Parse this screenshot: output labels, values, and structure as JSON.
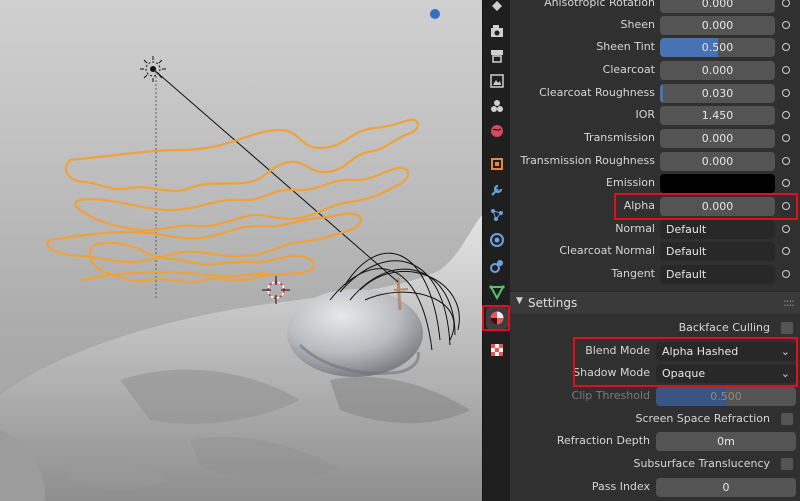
{
  "viewport": {
    "bg_color": "#bdbdbd",
    "curve_color": "#f0a23a"
  },
  "tabs": [
    {
      "name": "tool-icon",
      "color": "#cfcfcf"
    },
    {
      "name": "render-icon",
      "color": "#cfcfcf"
    },
    {
      "name": "output-icon",
      "color": "#cfcfcf"
    },
    {
      "name": "view-layer-icon",
      "color": "#cfcfcf"
    },
    {
      "name": "scene-icon",
      "color": "#cfcfcf"
    },
    {
      "name": "world-icon",
      "color": "#d64a5a"
    },
    {
      "name": "object-icon",
      "color": "#e8873a"
    },
    {
      "name": "modifier-icon",
      "color": "#6aa1e0"
    },
    {
      "name": "particles-icon",
      "color": "#6aa1e0"
    },
    {
      "name": "physics-icon",
      "color": "#6aa1e0"
    },
    {
      "name": "constraints-icon",
      "color": "#6aa1e0"
    },
    {
      "name": "data-icon",
      "color": "#56c26a"
    },
    {
      "name": "material-icon",
      "color": "#e05a5a",
      "active": true
    },
    {
      "name": "texture-icon",
      "color": "#e05a5a"
    }
  ],
  "props": {
    "anisotropic_rotation": {
      "label": "Anisotropic Rotation",
      "value": "0.000"
    },
    "sheen": {
      "label": "Sheen",
      "value": "0.000"
    },
    "sheen_tint": {
      "label": "Sheen Tint",
      "value": "0.500",
      "fraction": 0.5
    },
    "clearcoat": {
      "label": "Clearcoat",
      "value": "0.000"
    },
    "clearcoat_roughness": {
      "label": "Clearcoat Roughness",
      "value": "0.030",
      "fraction": 0.03
    },
    "ior": {
      "label": "IOR",
      "value": "1.450"
    },
    "transmission": {
      "label": "Transmission",
      "value": "0.000"
    },
    "transmission_roughness": {
      "label": "Transmission Roughness",
      "value": "0.000"
    },
    "emission": {
      "label": "Emission",
      "color": "#000000"
    },
    "alpha": {
      "label": "Alpha",
      "value": "0.000"
    },
    "normal": {
      "label": "Normal",
      "value": "Default"
    },
    "clearcoat_normal": {
      "label": "Clearcoat Normal",
      "value": "Default"
    },
    "tangent": {
      "label": "Tangent",
      "value": "Default"
    }
  },
  "settings": {
    "title": "Settings",
    "backface_culling": {
      "label": "Backface Culling",
      "checked": false
    },
    "blend_mode": {
      "label": "Blend Mode",
      "value": "Alpha Hashed"
    },
    "shadow_mode": {
      "label": "Shadow Mode",
      "value": "Opaque"
    },
    "clip_threshold": {
      "label": "Clip Threshold",
      "value": "0.500",
      "fraction": 0.5
    },
    "screen_space_refraction": {
      "label": "Screen Space Refraction",
      "checked": false
    },
    "refraction_depth": {
      "label": "Refraction Depth",
      "value": "0m"
    },
    "subsurface_translucency": {
      "label": "Subsurface Translucency",
      "checked": false
    },
    "pass_index": {
      "label": "Pass Index",
      "value": "0"
    }
  },
  "highlight_color": "#e0101a",
  "accent_color": "#4772b3"
}
